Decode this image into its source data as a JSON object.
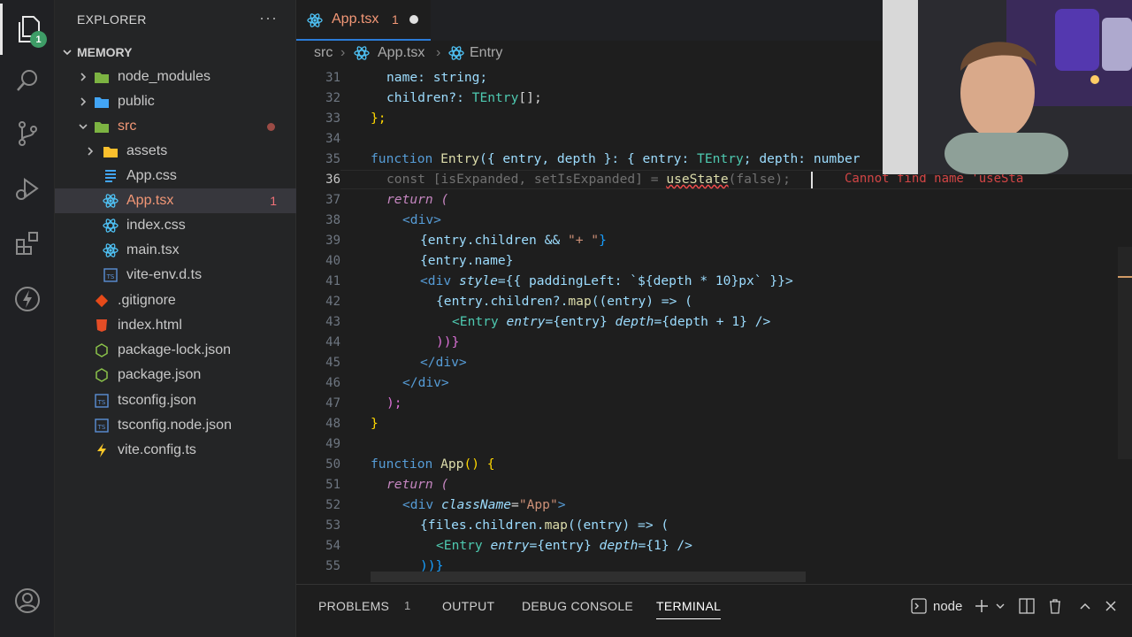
{
  "activity_bar": {
    "items": [
      "explorer-icon",
      "search-icon",
      "source-control-icon",
      "run-debug-icon",
      "extensions-icon",
      "lightning-icon"
    ],
    "explorer_badge": "1",
    "bottom": "account-icon"
  },
  "sidebar": {
    "title": "EXPLORER",
    "more": "···",
    "section": "MEMORY",
    "tree": [
      {
        "label": "node_modules",
        "icon": "folder-green-icon",
        "count": ""
      },
      {
        "label": "public",
        "icon": "folder-blue-icon",
        "count": ""
      },
      {
        "label": "src",
        "icon": "folder-green-icon",
        "count": ""
      },
      {
        "label": "assets",
        "icon": "folder-yellow-icon",
        "count": ""
      },
      {
        "label": "App.css",
        "icon": "css-file-icon",
        "count": ""
      },
      {
        "label": "App.tsx",
        "icon": "react-file-icon",
        "count": "1"
      },
      {
        "label": "index.css",
        "icon": "css-file-icon",
        "count": ""
      },
      {
        "label": "main.tsx",
        "icon": "react-file-icon",
        "count": ""
      },
      {
        "label": "vite-env.d.ts",
        "icon": "ts-file-icon",
        "count": ""
      },
      {
        "label": ".gitignore",
        "icon": "git-file-icon",
        "count": ""
      },
      {
        "label": "index.html",
        "icon": "html-file-icon",
        "count": ""
      },
      {
        "label": "package-lock.json",
        "icon": "npm-file-icon",
        "count": ""
      },
      {
        "label": "package.json",
        "icon": "npm-file-icon",
        "count": ""
      },
      {
        "label": "tsconfig.json",
        "icon": "ts-file-icon",
        "count": ""
      },
      {
        "label": "tsconfig.node.json",
        "icon": "ts-file-icon",
        "count": ""
      },
      {
        "label": "vite.config.ts",
        "icon": "vite-file-icon",
        "count": ""
      }
    ]
  },
  "editor": {
    "tab": {
      "label": "App.tsx",
      "count": "1"
    },
    "breadcrumb": [
      "src",
      "App.tsx",
      "Entry"
    ],
    "line_numbers": [
      "31",
      "32",
      "33",
      "34",
      "35",
      "36",
      "37",
      "38",
      "39",
      "40",
      "41",
      "42",
      "43",
      "44",
      "45",
      "46",
      "47",
      "48",
      "49",
      "50",
      "51",
      "52",
      "53",
      "54",
      "55"
    ],
    "current_line": "36",
    "error_message": "Cannot find name 'useSta",
    "code": {
      "l31": "name: string;",
      "l32_a": "children?: ",
      "l32_b": "TEntry",
      "l32_c": "[];",
      "l33": "};",
      "l35_kw": "function",
      "l35_fn": "Entry",
      "l35_rest": "({ entry, depth }: { entry: ",
      "l35_ty": "TEntry",
      "l35_rest2": "; depth: number",
      "l36_a": "const [isExpanded, setIsExpanded] = ",
      "l36_fn": "useState",
      "l36_b": "(false);",
      "l37": "return (",
      "l38": "<div>",
      "l39_a": "{entry.children && ",
      "l39_s": "\"+ \"",
      "l39_b": "}",
      "l40": "{entry.name}",
      "l41_a": "<div ",
      "l41_at": "style",
      "l41_b": "={{ paddingLeft: `${depth * 10}px` }}>",
      "l42_a": "{entry.children?.",
      "l42_fn": "map",
      "l42_b": "((entry) => (",
      "l43_cp": "<Entry ",
      "l43_at1": "entry",
      "l43_b": "={entry} ",
      "l43_at2": "depth",
      "l43_c": "={depth + 1} />",
      "l44": "))}",
      "l45": "</div>",
      "l46": "</div>",
      "l47": ");",
      "l48": "}",
      "l50_kw": "function",
      "l50_fn": "App",
      "l50_rest": "() {",
      "l51": "return (",
      "l52_a": "<div ",
      "l52_at": "className",
      "l52_b": "=",
      "l52_s": "\"App\"",
      "l52_c": ">",
      "l53_a": "{files.children.",
      "l53_fn": "map",
      "l53_b": "((entry) => (",
      "l54_cp": "<Entry ",
      "l54_at1": "entry",
      "l54_b": "={entry} ",
      "l54_at2": "depth",
      "l54_c": "={1} />",
      "l55": "))}"
    }
  },
  "panel": {
    "tabs": [
      "PROBLEMS",
      "OUTPUT",
      "DEBUG CONSOLE",
      "TERMINAL"
    ],
    "problems_count": "1",
    "active_tab": "TERMINAL",
    "terminal_name": "node"
  }
}
